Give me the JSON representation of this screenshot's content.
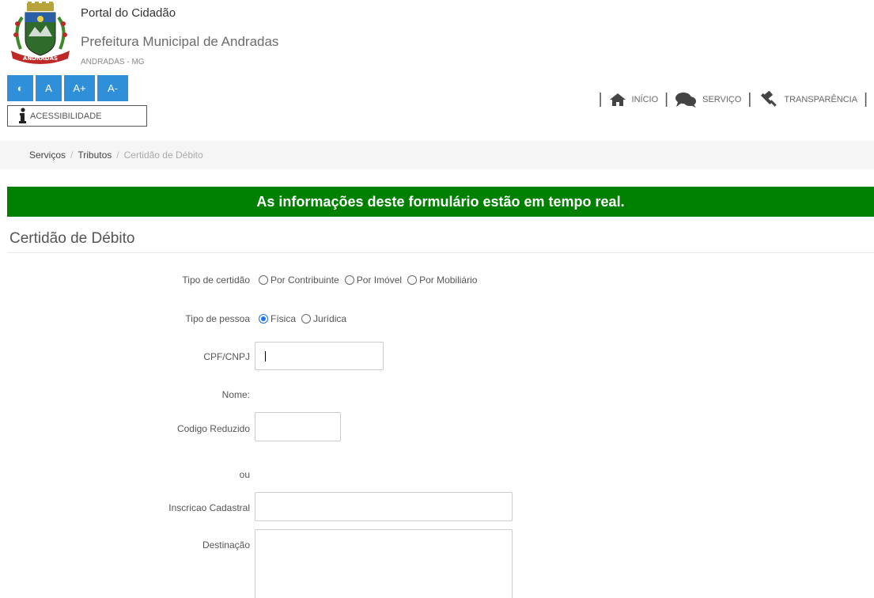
{
  "header": {
    "portal_title": "Portal do Cidadão",
    "prefeitura": "Prefeitura Municipal de Andradas",
    "local": "ANDRADAS - MG",
    "logo_text": "ANDRADAS"
  },
  "accessibility": {
    "buttons": [
      "◐",
      "A",
      "A+",
      "A-"
    ],
    "label": "ACESSIBILIDADE",
    "color": "#2f8fd8"
  },
  "nav": {
    "items": [
      {
        "label": "INÍCIO",
        "icon": "home-icon"
      },
      {
        "label": "SERVIÇO",
        "icon": "comments-icon"
      },
      {
        "label": "TRANSPARÊNCIA",
        "icon": "gavel-icon"
      }
    ]
  },
  "breadcrumb": {
    "items": [
      "Serviços",
      "Tributos"
    ],
    "current": "Certidão de Débito"
  },
  "banner": {
    "text": "As informações deste formulário estão em tempo real.",
    "color": "#008000"
  },
  "form": {
    "title": "Certidão de Débito",
    "tipo_certidao": {
      "label": "Tipo de certidão",
      "options": [
        "Por Contribuinte",
        "Por Imóvel",
        "Por Mobiliário"
      ]
    },
    "tipo_pessoa": {
      "label": "Tipo de pessoa",
      "options": [
        "Física",
        "Jurídica"
      ],
      "selected": "Física"
    },
    "cpf": {
      "label": "CPF/CNPJ",
      "value": ""
    },
    "nome": {
      "label": "Nome:"
    },
    "codigo": {
      "label": "Codigo Reduzido",
      "value": ""
    },
    "ou": "ou",
    "inscricao": {
      "label": "Inscricao Cadastral",
      "value": ""
    },
    "destinacao": {
      "label": "Destinação",
      "value": ""
    }
  }
}
